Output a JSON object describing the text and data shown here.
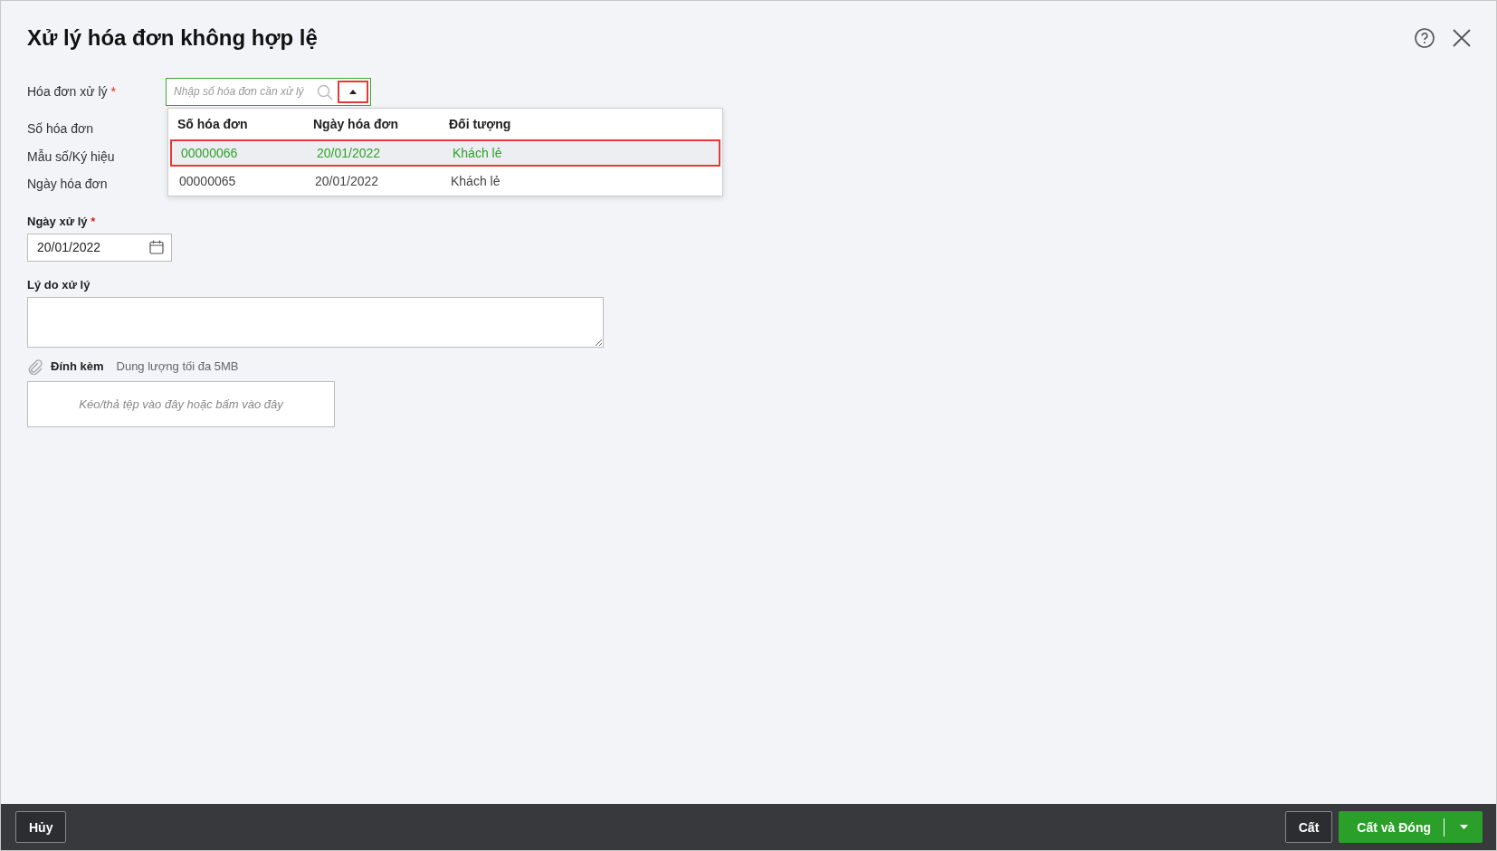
{
  "dialog": {
    "title": "Xử lý hóa đơn không hợp lệ"
  },
  "invoice_field": {
    "label": "Hóa đơn xử lý",
    "required_mark": "*",
    "placeholder": "Nhập số hóa đơn cần xử lý",
    "dropdown_highlighted": true,
    "expanded": true
  },
  "dropdown": {
    "columns": [
      "Số hóa đơn",
      "Ngày hóa đơn",
      "Đối tượng"
    ],
    "rows": [
      {
        "cells": [
          "00000066",
          "20/01/2022",
          "Khách lẻ"
        ],
        "selected": true
      },
      {
        "cells": [
          "00000065",
          "20/01/2022",
          "Khách lẻ"
        ],
        "selected": false
      }
    ]
  },
  "info_labels": [
    "Số hóa đơn",
    "Mẫu số/Ký hiệu",
    "Ngày hóa đơn"
  ],
  "date_field": {
    "label": "Ngày xử lý",
    "required_mark": "*",
    "value": "20/01/2022"
  },
  "reason_field": {
    "label": "Lý do xử lý"
  },
  "attachment": {
    "label": "Đính kèm",
    "hint": "Dung lượng tối đa 5MB",
    "dropzone": "Kéo/thả tệp vào đây hoặc bấm vào đây"
  },
  "footer": {
    "cancel": "Hủy",
    "save": "Cất",
    "save_close": "Cất và Đóng"
  }
}
